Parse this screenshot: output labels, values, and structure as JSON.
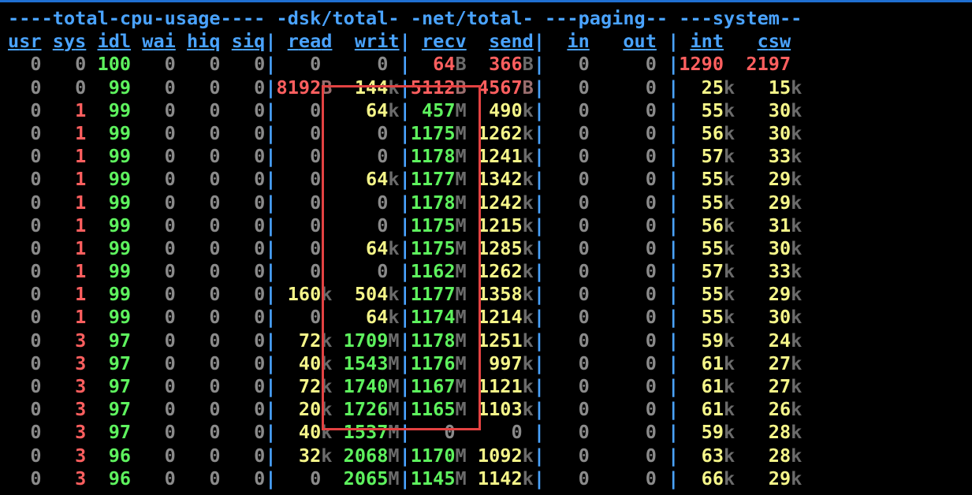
{
  "app": {
    "accent": "#1f6fd1",
    "colors": {
      "header": "#4aa3ff",
      "zero": "#8a8a8a",
      "red": "#ff5f5f",
      "yellow": "#f5f589",
      "green": "#5ef25e",
      "suffix": "#6b6b6b"
    },
    "highlight_color": "#e34242"
  },
  "dstat": {
    "group_header": "----total-cpu-usage---- -dsk/total- -net/total- ---paging-- ---system--",
    "column_header": "usr sys idl wai hiq siq| read  writ| recv  send|  in   out | int   csw ",
    "rows": [
      "  0   0 100   0   0   0|   0     0 |  64B  366B|   0     0 |1290  2197 ",
      "  0   0  99   0   0   0|8192B  144k|5112B 4567B|   0     0 |  25k   15k",
      "  0   1  99   0   0   0|   0    64k| 457M  490k|   0     0 |  55k   30k",
      "  0   1  99   0   0   0|   0     0 |1175M 1262k|   0     0 |  56k   30k",
      "  0   1  99   0   0   0|   0     0 |1178M 1241k|   0     0 |  57k   33k",
      "  0   1  99   0   0   0|   0    64k|1177M 1342k|   0     0 |  55k   29k",
      "  0   1  99   0   0   0|   0     0 |1178M 1242k|   0     0 |  55k   29k",
      "  0   1  99   0   0   0|   0     0 |1175M 1215k|   0     0 |  56k   31k",
      "  0   1  99   0   0   0|   0    64k|1175M 1285k|   0     0 |  55k   30k",
      "  0   1  99   0   0   0|   0     0 |1162M 1262k|   0     0 |  57k   33k",
      "  0   1  99   0   0   0| 160k  504k|1177M 1358k|   0     0 |  55k   29k",
      "  0   1  99   0   0   0|   0    64k|1174M 1214k|   0     0 |  55k   30k",
      "  0   3  97   0   0   0|  72k 1709M|1178M 1251k|   0     0 |  59k   24k",
      "  0   3  97   0   0   0|  40k 1543M|1176M  997k|   0     0 |  61k   27k",
      "  0   3  97   0   0   0|  72k 1740M|1167M 1121k|   0     0 |  61k   27k",
      "  0   3  97   0   0   0|  20k 1726M|1165M 1103k|   0     0 |  61k   26k",
      "  0   3  97   0   0   0|  40k 1537M|   0     0 |   0     0 |  59k   28k",
      "  0   3  96   0   0   0|  32k 2068M|1170M 1092k|   0     0 |  63k   28k",
      "  0   3  96   0   0   0|   0  2065M|1145M 1142k|   0     0 |  66k   29k"
    ]
  }
}
